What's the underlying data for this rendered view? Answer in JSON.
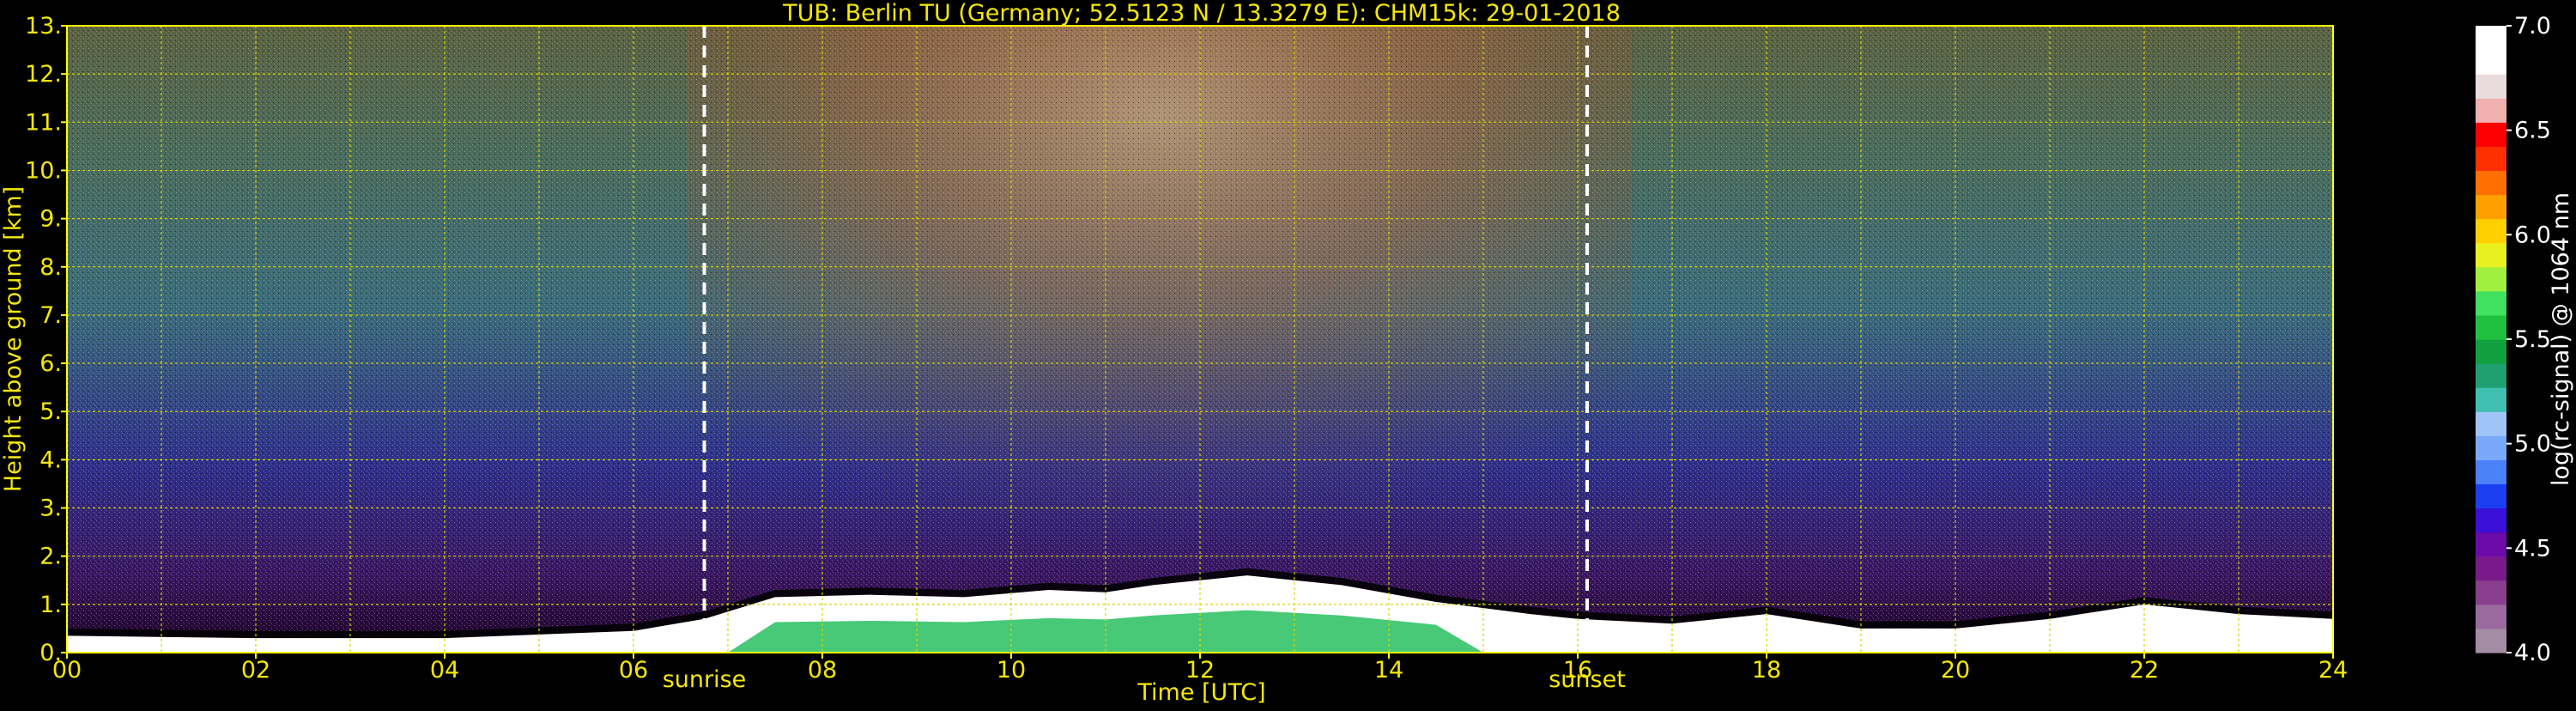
{
  "chart_data": {
    "type": "heatmap",
    "title": "TUB: Berlin TU (Germany; 52.5123 N / 13.3279 E):    CHM15k: 29-01-2018",
    "xlabel": "Time [UTC]",
    "ylabel": "Height above ground [km]",
    "xlim": [
      0,
      24
    ],
    "ylim": [
      0,
      13
    ],
    "x_ticks": [
      0,
      2,
      4,
      6,
      8,
      10,
      12,
      14,
      16,
      18,
      20,
      22,
      24
    ],
    "x_tick_labels": [
      "00",
      "02",
      "04",
      "06",
      "08",
      "10",
      "12",
      "14",
      "16",
      "18",
      "20",
      "22",
      "24"
    ],
    "y_ticks": [
      0,
      1,
      2,
      3,
      4,
      5,
      6,
      7,
      8,
      9,
      10,
      11,
      12,
      13
    ],
    "y_tick_labels": [
      "0.",
      "1.",
      "2.",
      "3.",
      "4.",
      "5.",
      "6.",
      "7.",
      "8.",
      "9.",
      "10.",
      "11.",
      "12.",
      "13."
    ],
    "grid": true,
    "events": [
      {
        "name": "sunrise",
        "x": 6.75
      },
      {
        "name": "sunset",
        "x": 16.1
      }
    ],
    "boundary_layer_top_km": [
      [
        0,
        0.35
      ],
      [
        2,
        0.3
      ],
      [
        4,
        0.3
      ],
      [
        6,
        0.45
      ],
      [
        6.75,
        0.7
      ],
      [
        7.5,
        1.15
      ],
      [
        8.5,
        1.2
      ],
      [
        9.5,
        1.15
      ],
      [
        10.4,
        1.3
      ],
      [
        11.0,
        1.25
      ],
      [
        11.5,
        1.4
      ],
      [
        12.5,
        1.6
      ],
      [
        13.5,
        1.4
      ],
      [
        14.5,
        1.05
      ],
      [
        15.5,
        0.8
      ],
      [
        16.0,
        0.7
      ],
      [
        17,
        0.6
      ],
      [
        18,
        0.8
      ],
      [
        19,
        0.5
      ],
      [
        20,
        0.5
      ],
      [
        21,
        0.7
      ],
      [
        22,
        1.0
      ],
      [
        23,
        0.8
      ],
      [
        24,
        0.7
      ]
    ],
    "colorbar": {
      "label": "log(rc-signal) @ 1064 nm",
      "min": 4.0,
      "max": 7.0,
      "tick_values": [
        4.0,
        4.5,
        5.0,
        5.5,
        6.0,
        6.5,
        7.0
      ],
      "tick_labels": [
        "4.0",
        "4.5",
        "5.0",
        "5.5",
        "6.0",
        "6.5",
        "7.0"
      ],
      "colors": [
        "#a48ca4",
        "#9a6a9e",
        "#8a3f8e",
        "#7a1a8a",
        "#6a0aa8",
        "#3a10d8",
        "#1a3ef0",
        "#4a80f8",
        "#7aa8f8",
        "#a0c4f8",
        "#40c0b0",
        "#20a070",
        "#10a040",
        "#20c040",
        "#40e060",
        "#a0f040",
        "#e8f020",
        "#ffd000",
        "#ffa000",
        "#ff7000",
        "#ff3000",
        "#ff0000",
        "#f0b0b0",
        "#e8dcdc",
        "#ffffff",
        "#ffffff"
      ]
    }
  },
  "colors": {
    "axis_text": "#f5e70a",
    "frame": "#ffff00",
    "grid": "#d4d400",
    "event_line": "#ffffff"
  }
}
